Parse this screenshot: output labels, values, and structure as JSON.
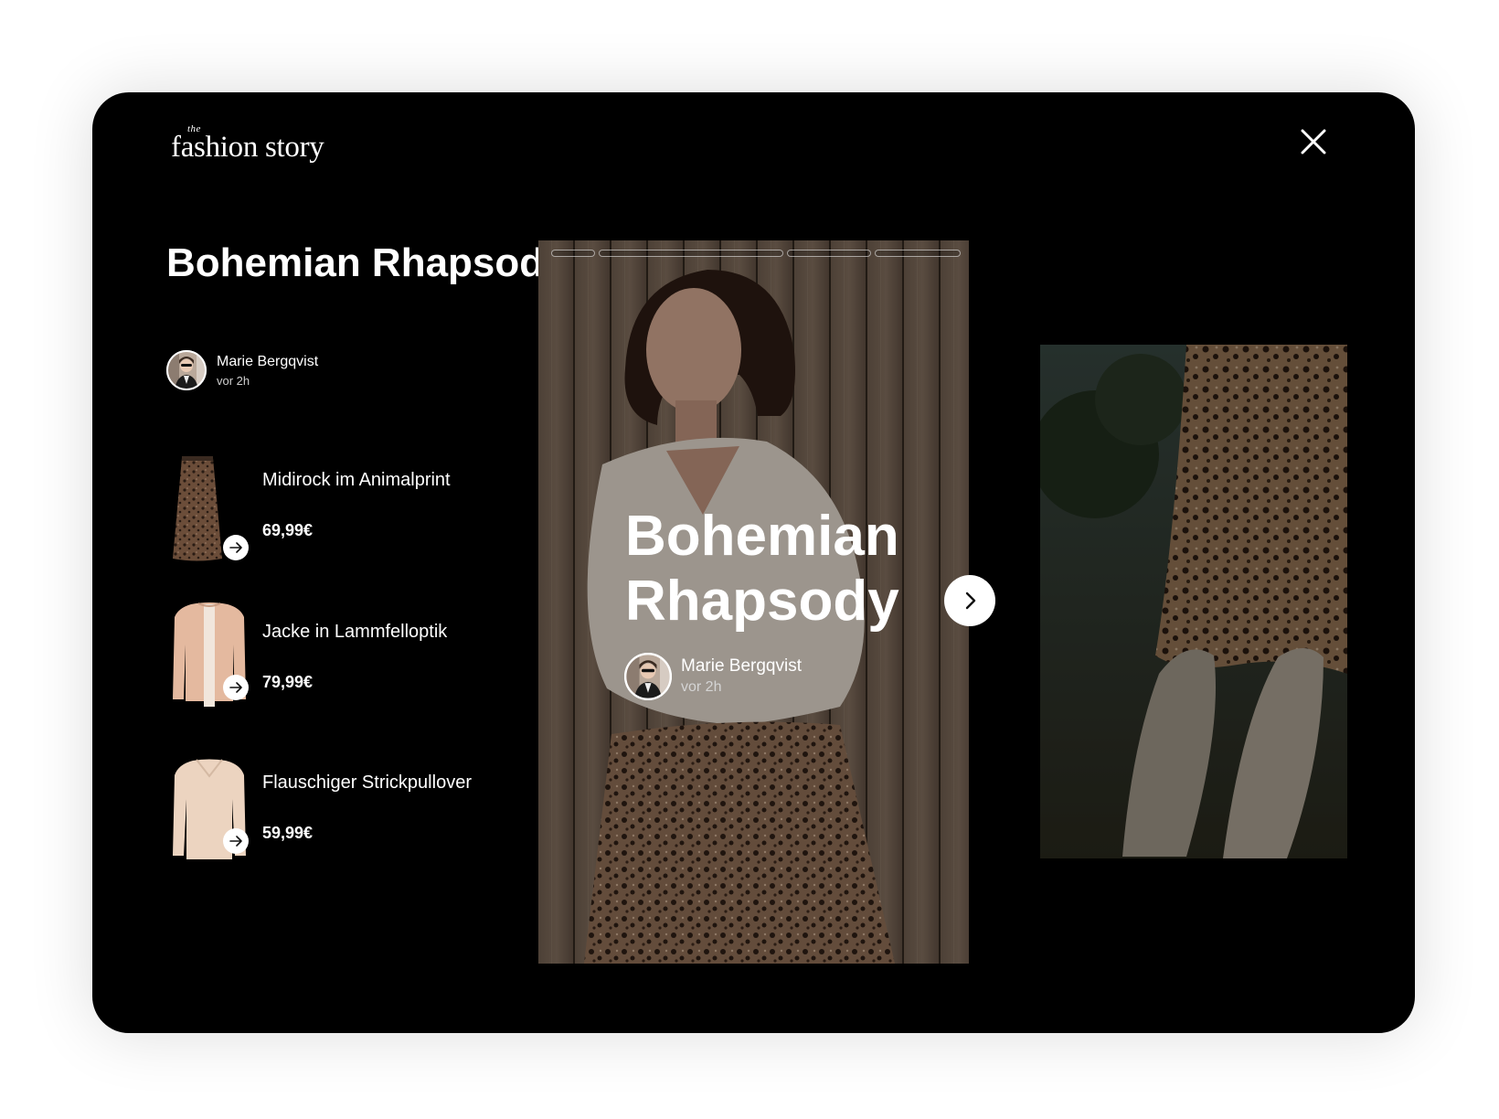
{
  "brand": {
    "prefix": "the",
    "name": "fashion story"
  },
  "story": {
    "title": "Bohemian Rhapsody",
    "author": "Marie Bergqvist",
    "time": "vor 2h",
    "progress_segments": 4,
    "progress_active_index": 1
  },
  "products": [
    {
      "name": "Midirock im Animalprint",
      "price": "69,99€",
      "icon": "arrow-right-icon",
      "color": "#5a4334"
    },
    {
      "name": "Jacke in Lammfelloptik",
      "price": "79,99€",
      "icon": "arrow-right-icon",
      "color": "#e4b99f"
    },
    {
      "name": "Flauschiger Strickpullover",
      "price": "59,99€",
      "icon": "arrow-right-icon",
      "color": "#ecd4c0"
    }
  ],
  "icons": {
    "close": "close-icon",
    "next": "chevron-right-icon"
  },
  "colors": {
    "background": "#000000",
    "text": "#ffffff"
  }
}
